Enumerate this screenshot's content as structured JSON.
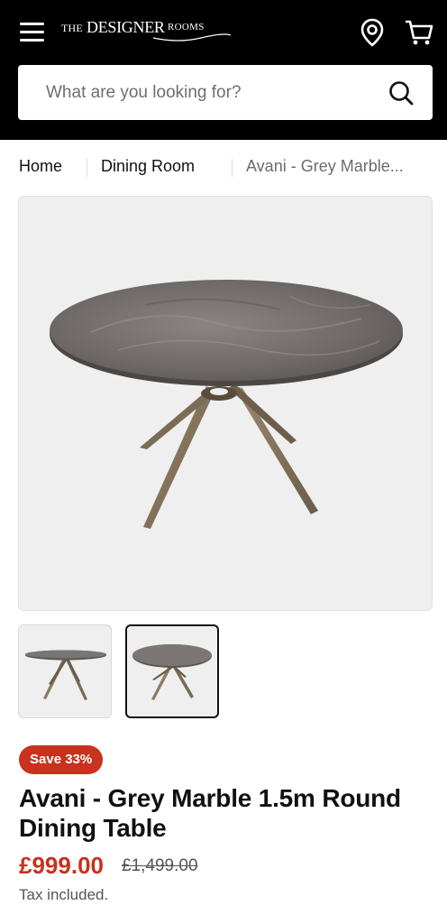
{
  "header": {
    "logo": {
      "the": "THE",
      "main": "DESIGNER",
      "rooms": "ROOMS"
    },
    "icons": [
      "menu-icon",
      "location-pin-icon",
      "cart-icon"
    ]
  },
  "search": {
    "placeholder": "What are you looking for?",
    "value": ""
  },
  "breadcrumb": {
    "home": "Home",
    "category": "Dining Room",
    "current": "Avani - Grey Marble..."
  },
  "product": {
    "badge": "Save 33%",
    "title": "Avani - Grey Marble 1.5m Round Dining Table",
    "price": "£999.00",
    "compare_price": "£1,499.00",
    "tax_note": "Tax included.",
    "thumbnails": [
      "side view",
      "top view"
    ],
    "selected_thumbnail": 2
  },
  "colors": {
    "header_bg": "#000000",
    "accent_red": "#c8321e",
    "image_bg": "#efefef"
  }
}
